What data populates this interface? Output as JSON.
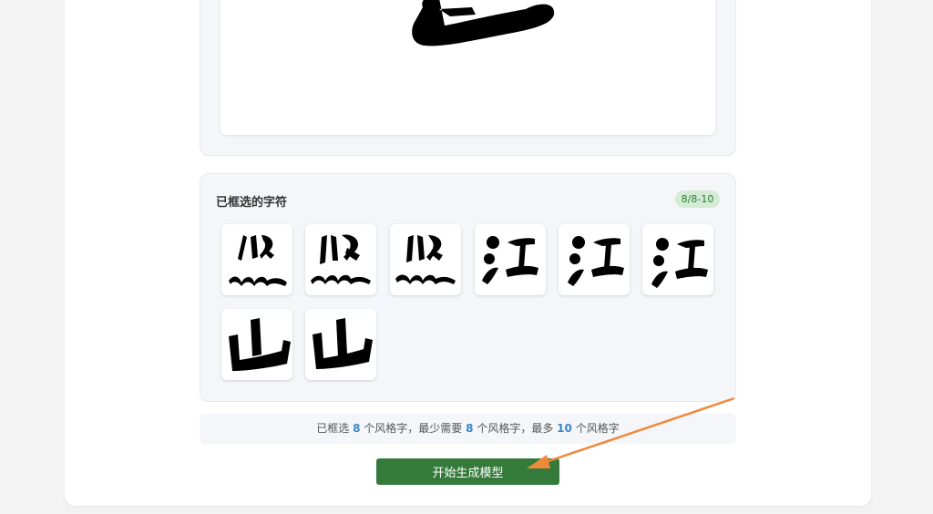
{
  "colors": {
    "accent_green": "#347a3a",
    "badge_bg": "#d4ecd6",
    "badge_text": "#2e7d32",
    "number_blue": "#3a86c8",
    "annotation_arrow": "#f0883a"
  },
  "selected_panel": {
    "title": "已框选的字符",
    "badge": "8/8-10",
    "thumbnails": [
      {
        "char": "照",
        "icon": "glyph-thumbnail"
      },
      {
        "char": "照",
        "icon": "glyph-thumbnail"
      },
      {
        "char": "照",
        "icon": "glyph-thumbnail"
      },
      {
        "char": "江",
        "icon": "glyph-thumbnail"
      },
      {
        "char": "江",
        "icon": "glyph-thumbnail"
      },
      {
        "char": "江",
        "icon": "glyph-thumbnail"
      },
      {
        "char": "山",
        "icon": "glyph-thumbnail"
      },
      {
        "char": "山",
        "icon": "glyph-thumbnail"
      }
    ]
  },
  "info": {
    "prefix": "已框选",
    "selected": "8",
    "part1": "个风格字，最少需要",
    "min": "8",
    "part2": "个风格字，最多",
    "max": "10",
    "part3": "个风格字"
  },
  "button": {
    "label": "开始生成模型"
  }
}
